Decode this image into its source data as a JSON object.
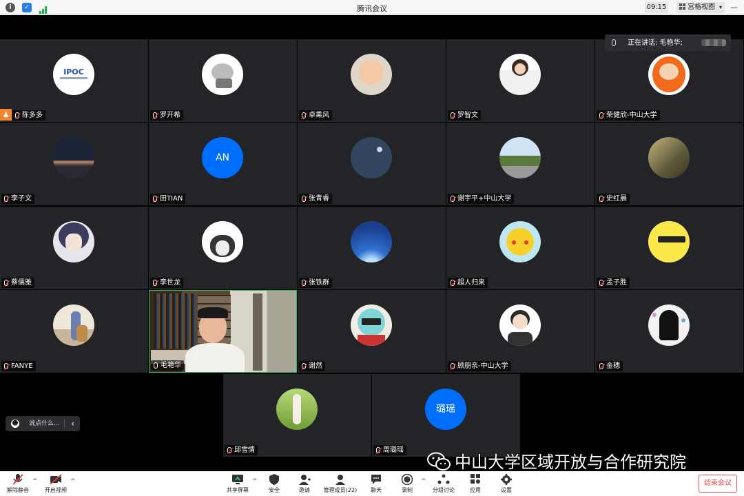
{
  "window": {
    "title": "腾讯会议",
    "time": "09:15",
    "view_label": "宫格视图"
  },
  "speaking": {
    "label": "正在讲话: 毛艳华;"
  },
  "chat": {
    "placeholder": "说点什么..."
  },
  "watermark": {
    "text": "中山大学区域开放与合作研究院"
  },
  "participants": [
    {
      "name": "陈多多",
      "avatar": "logo",
      "avatar_text": "IPOC"
    },
    {
      "name": "罗开希",
      "avatar": "cat"
    },
    {
      "name": "卓乘风",
      "avatar": "baby"
    },
    {
      "name": "罗智文",
      "avatar": "girl"
    },
    {
      "name": "荣健欣-中山大学",
      "avatar": "kenny"
    },
    {
      "name": "李子文",
      "avatar": "sunset"
    },
    {
      "name": "田TIAN",
      "avatar": "text",
      "avatar_text": "AN"
    },
    {
      "name": "张青睿",
      "avatar": "night"
    },
    {
      "name": "谢宇平+中山大学",
      "avatar": "street"
    },
    {
      "name": "史红晨",
      "avatar": "painting"
    },
    {
      "name": "蔡儒雅",
      "avatar": "anime"
    },
    {
      "name": "李世龙",
      "avatar": "dog"
    },
    {
      "name": "张铁群",
      "avatar": "sky"
    },
    {
      "name": "超人归来",
      "avatar": "pikachu"
    },
    {
      "name": "孟子胜",
      "avatar": "yellow"
    },
    {
      "name": "FANYE",
      "avatar": "kid"
    },
    {
      "name": "毛艳华",
      "avatar": "video"
    },
    {
      "name": "谢然",
      "avatar": "mask"
    },
    {
      "name": "顾朋亲-中山大学",
      "avatar": "boy"
    },
    {
      "name": "金穗",
      "avatar": "art"
    },
    {
      "name": "邱雪情",
      "avatar": "grass"
    },
    {
      "name": "周璐瑶",
      "avatar": "text",
      "avatar_text": "璐瑶"
    }
  ],
  "toolbar": {
    "unmute": "解除静音",
    "start_video": "开启视频",
    "share_screen": "共享屏幕",
    "security": "安全",
    "invite": "邀请",
    "manage_members": "管理成员(22)",
    "chat": "聊天",
    "record": "录制",
    "breakout": "分组讨论",
    "apps": "应用",
    "settings": "设置",
    "end_meeting": "结束会议"
  },
  "colors": {
    "accent": "#006efd",
    "tile": "#232427",
    "end": "#e34d4d",
    "host_badge": "#f5862b"
  }
}
